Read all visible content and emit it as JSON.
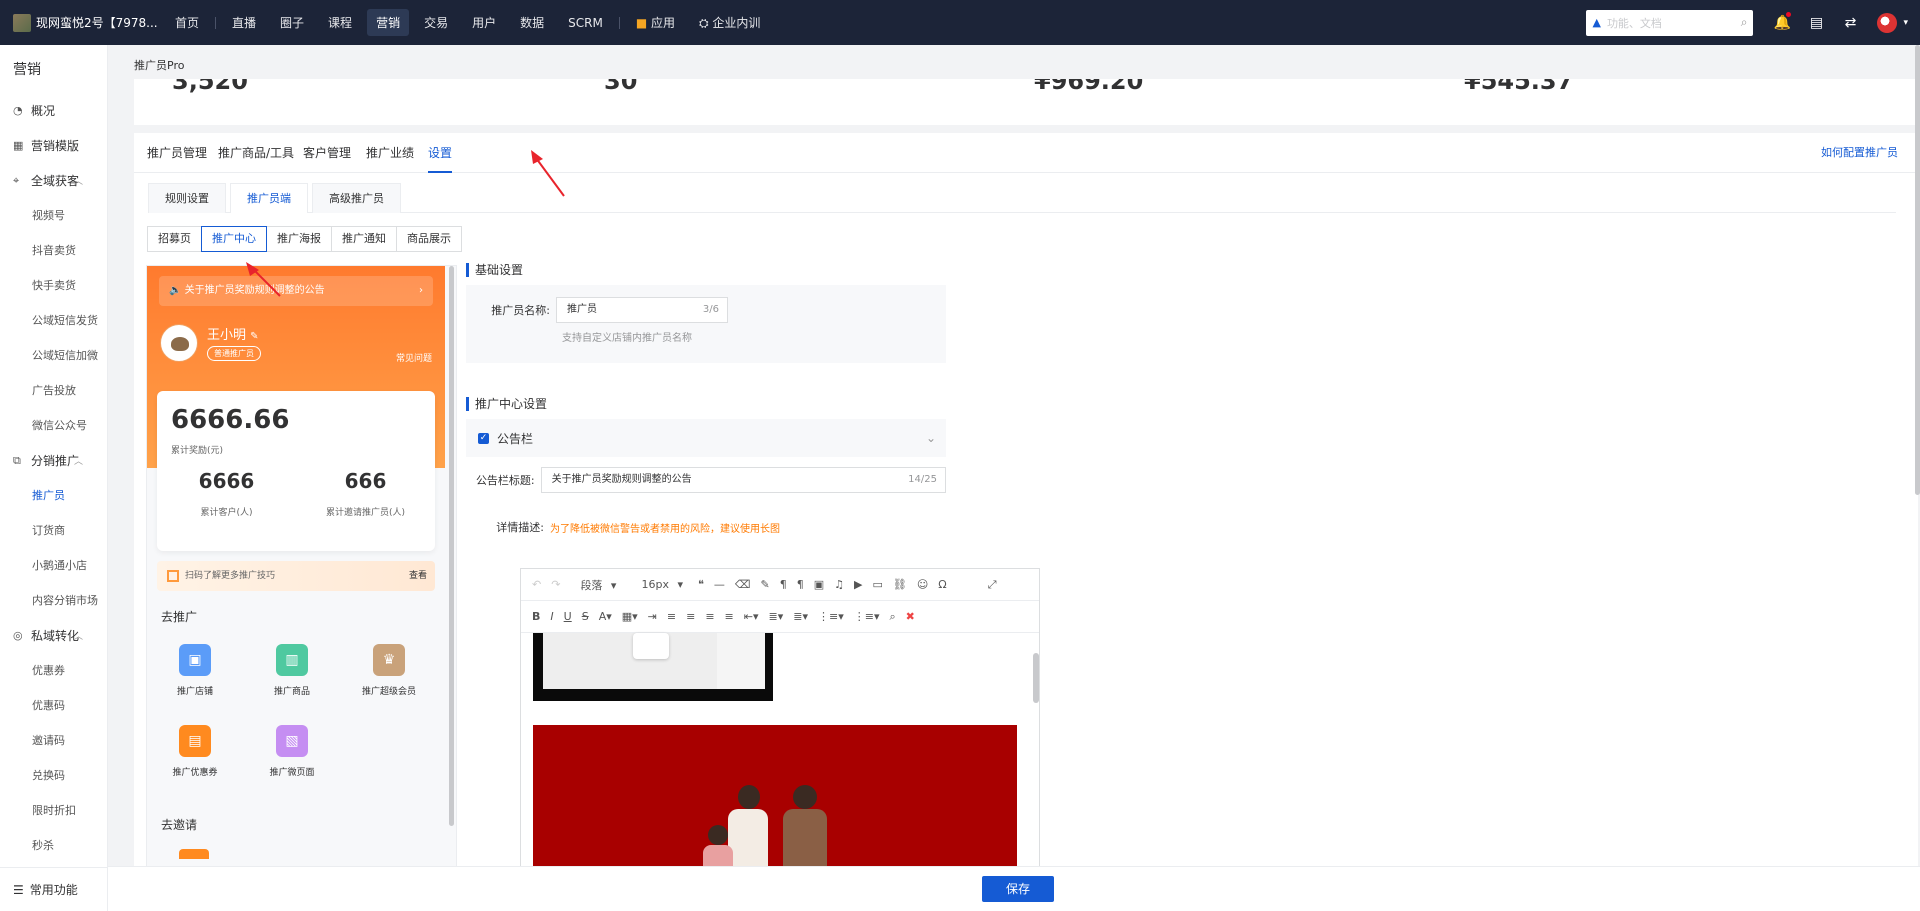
{
  "topbar": {
    "shop_name": "现网蛮悦2号【7978...",
    "nav": [
      "首页",
      "直播",
      "圈子",
      "课程",
      "营销",
      "交易",
      "用户",
      "数据",
      "SCRM",
      "应用",
      "企业内训"
    ],
    "active_nav": "营销",
    "search_placeholder": "功能、文档"
  },
  "sidebar": {
    "title": "营销",
    "groups": [
      {
        "label": "概况",
        "icon": "chart-icon"
      },
      {
        "label": "营销模版",
        "icon": "grid-icon"
      },
      {
        "label": "全域获客",
        "icon": "target-icon",
        "items": [
          "视频号",
          "抖音卖货",
          "快手卖货",
          "公域短信发货",
          "公域短信加微",
          "广告投放",
          "微信公众号"
        ]
      },
      {
        "label": "分销推广",
        "icon": "share-icon",
        "items": [
          "推广员",
          "订货商",
          "小鹅通小店",
          "内容分销市场"
        ]
      },
      {
        "label": "私域转化",
        "icon": "convert-icon",
        "items": [
          "优惠券",
          "优惠码",
          "邀请码",
          "兑换码",
          "限时折扣",
          "秒杀"
        ]
      }
    ],
    "active_item": "推广员",
    "footer": "常用功能"
  },
  "breadcrumb": "推广员Pro",
  "stats": [
    "3,520",
    "30",
    "¥969.20",
    "¥545.37"
  ],
  "tabs_main": [
    "推广员管理",
    "推广商品/工具",
    "客户管理",
    "推广业绩",
    "设置"
  ],
  "tabs_main_active": "设置",
  "help_link": "如何配置推广员",
  "tabs_sub": [
    "规则设置",
    "推广员端",
    "高级推广员"
  ],
  "tabs_sub_active": "推广员端",
  "tabs_third": [
    "招募页",
    "推广中心",
    "推广海报",
    "推广通知",
    "商品展示"
  ],
  "tabs_third_active": "推广中心",
  "preview": {
    "notice": "关于推广员奖励规则调整的公告",
    "user_name": "王小明",
    "user_badge": "普通推广员",
    "faq": "常见问题",
    "reward_amount": "6666.66",
    "reward_label": "累计奖励(元)",
    "customers": "6666",
    "customers_label": "累计客户(人)",
    "invited": "666",
    "invited_label": "累计邀请推广员(人)",
    "tip": "扫码了解更多推广技巧",
    "tip_action": "查看",
    "section_promote": "去推广",
    "promote_items": [
      "推广店铺",
      "推广商品",
      "推广超级会员",
      "推广优惠券",
      "推广微页面"
    ],
    "section_invite": "去邀请"
  },
  "settings": {
    "basic_title": "基础设置",
    "name_label": "推广员名称:",
    "name_value": "推广员",
    "name_count": "3/6",
    "name_hint": "支持自定义店铺内推广员名称",
    "center_title": "推广中心设置",
    "notice_checkbox": "公告栏",
    "notice_title_label": "公告栏标题:",
    "notice_title_value": "关于推广员奖励规则调整的公告",
    "notice_title_count": "14/25",
    "detail_label": "详情描述:",
    "detail_warning": "为了降低被微信警告或者禁用的风险，建议使用长图",
    "editor_paragraph": "段落",
    "editor_fontsize": "16px"
  },
  "save_button": "保存",
  "colors": {
    "accent": "#155bd4",
    "topbar": "#1c2438",
    "orange": "#ff7a2e",
    "arrow": "#e8242c"
  }
}
